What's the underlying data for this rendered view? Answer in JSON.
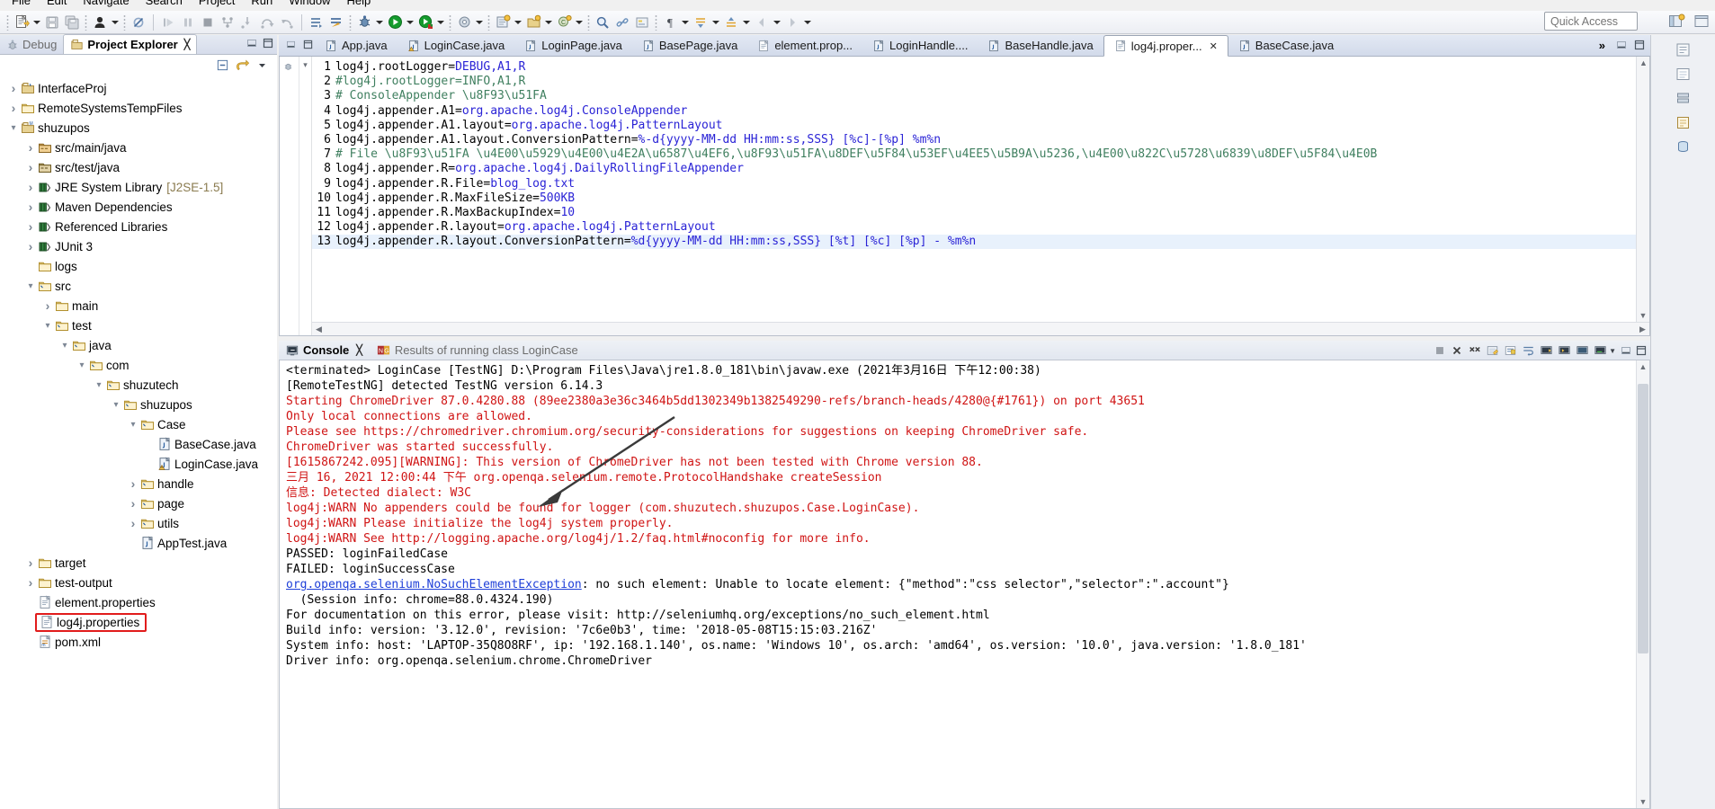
{
  "menu": {
    "items": [
      {
        "label": "File"
      },
      {
        "label": "Edit"
      },
      {
        "label": "Navigate"
      },
      {
        "label": "Search"
      },
      {
        "label": "Project"
      },
      {
        "label": "Run"
      },
      {
        "label": "Window"
      },
      {
        "label": "Help"
      }
    ]
  },
  "toolbar": {
    "quick_access_placeholder": "Quick Access",
    "icons": [
      "new-file-icon",
      "new-dropdown-icon",
      "save-icon",
      "save-all-icon",
      "user-icon",
      "user-dropdown-icon",
      "skip-breakpoints-icon",
      "resume-icon",
      "suspend-icon",
      "terminate-icon",
      "disconnect-icon",
      "step-into-icon",
      "step-over-icon",
      "step-return-icon",
      "open-task-icon",
      "open-type-icon",
      "debug-icon",
      "debug-dropdown-icon",
      "run-icon",
      "run-dropdown-icon",
      "coverage-icon",
      "coverage-dropdown-icon",
      "external-tools-icon",
      "external-tools-dropdown-icon",
      "new-java-project-icon",
      "new-package-icon",
      "new-class-icon",
      "search-icon",
      "link-icon",
      "toggle-markoccurrences-icon",
      "pilcrow-icon",
      "pilcrow-dropdown-icon",
      "forward-icon",
      "back-icon",
      "next-annotation-icon",
      "prev-annotation-icon"
    ]
  },
  "left_panel": {
    "tabs": [
      {
        "label": "Debug",
        "icon": "debug-icon",
        "active": false
      },
      {
        "label": "Project Explorer",
        "icon": "project-explorer-icon",
        "active": true,
        "closeable": true
      }
    ],
    "view_tools": [
      "collapse-all-icon",
      "link-with-editor-icon",
      "view-menu-icon"
    ],
    "tree": [
      {
        "indent": 0,
        "twist": "closed",
        "icon": "java-project-icon",
        "label": "InterfaceProj"
      },
      {
        "indent": 0,
        "twist": "closed",
        "icon": "folder-icon",
        "label": "RemoteSystemsTempFiles"
      },
      {
        "indent": 0,
        "twist": "open",
        "icon": "maven-project-icon",
        "label": "shuzupos"
      },
      {
        "indent": 1,
        "twist": "closed",
        "icon": "source-folder-icon",
        "label": "src/main/java"
      },
      {
        "indent": 1,
        "twist": "closed",
        "icon": "test-source-folder-icon",
        "label": "src/test/java"
      },
      {
        "indent": 1,
        "twist": "closed",
        "icon": "library-icon",
        "label": "JRE System Library",
        "dim": "[J2SE-1.5]"
      },
      {
        "indent": 1,
        "twist": "closed",
        "icon": "library-icon",
        "label": "Maven Dependencies"
      },
      {
        "indent": 1,
        "twist": "closed",
        "icon": "library-icon",
        "label": "Referenced Libraries"
      },
      {
        "indent": 1,
        "twist": "closed",
        "icon": "library-icon",
        "label": "JUnit 3"
      },
      {
        "indent": 1,
        "twist": "none",
        "icon": "folder-icon",
        "label": "logs"
      },
      {
        "indent": 1,
        "twist": "open",
        "icon": "src-folder-icon",
        "label": "src"
      },
      {
        "indent": 2,
        "twist": "closed",
        "icon": "folder-icon",
        "label": "main"
      },
      {
        "indent": 2,
        "twist": "open",
        "icon": "src-folder-icon",
        "label": "test"
      },
      {
        "indent": 3,
        "twist": "open",
        "icon": "src-folder-icon",
        "label": "java"
      },
      {
        "indent": 4,
        "twist": "open",
        "icon": "src-folder-icon",
        "label": "com"
      },
      {
        "indent": 5,
        "twist": "open",
        "icon": "src-folder-icon",
        "label": "shuzutech"
      },
      {
        "indent": 6,
        "twist": "open",
        "icon": "src-folder-icon",
        "label": "shuzupos"
      },
      {
        "indent": 7,
        "twist": "open",
        "icon": "src-folder-icon",
        "label": "Case"
      },
      {
        "indent": 8,
        "twist": "none",
        "icon": "java-file-icon",
        "label": "BaseCase.java"
      },
      {
        "indent": 8,
        "twist": "none",
        "icon": "java-file-warning-icon",
        "label": "LoginCase.java"
      },
      {
        "indent": 7,
        "twist": "closed",
        "icon": "src-folder-icon",
        "label": "handle"
      },
      {
        "indent": 7,
        "twist": "closed",
        "icon": "src-folder-icon",
        "label": "page"
      },
      {
        "indent": 7,
        "twist": "closed",
        "icon": "src-folder-icon",
        "label": "utils"
      },
      {
        "indent": 7,
        "twist": "none",
        "icon": "java-file-icon",
        "label": "AppTest.java"
      },
      {
        "indent": 1,
        "twist": "closed",
        "icon": "folder-icon",
        "label": "target"
      },
      {
        "indent": 1,
        "twist": "closed",
        "icon": "folder-icon",
        "label": "test-output"
      },
      {
        "indent": 1,
        "twist": "none",
        "icon": "properties-file-icon",
        "label": "element.properties"
      },
      {
        "indent": 1,
        "twist": "none",
        "icon": "properties-file-icon",
        "label": "log4j.properties",
        "selected": true
      },
      {
        "indent": 1,
        "twist": "none",
        "icon": "pom-file-icon",
        "label": "pom.xml"
      }
    ]
  },
  "editor": {
    "tabs": [
      {
        "label": "App.java",
        "icon": "java-file-icon",
        "active": false
      },
      {
        "label": "LoginCase.java",
        "icon": "java-file-warning-icon",
        "active": false
      },
      {
        "label": "LoginPage.java",
        "icon": "java-file-icon",
        "active": false
      },
      {
        "label": "BasePage.java",
        "icon": "java-file-icon",
        "active": false
      },
      {
        "label": "element.prop...",
        "icon": "properties-file-icon",
        "active": false
      },
      {
        "label": "LoginHandle....",
        "icon": "java-file-icon",
        "active": false
      },
      {
        "label": "BaseHandle.java",
        "icon": "java-file-icon",
        "active": false
      },
      {
        "label": "log4j.proper...",
        "icon": "properties-file-icon",
        "active": true,
        "closeable": true
      },
      {
        "label": "BaseCase.java",
        "icon": "java-file-icon",
        "active": false
      }
    ],
    "more_tabs_label": "»",
    "lines": [
      {
        "no": "1",
        "segs": [
          {
            "t": "log4j.rootLogger=",
            "c": "key"
          },
          {
            "t": "DEBUG,A1,R",
            "c": "val"
          }
        ]
      },
      {
        "no": "2",
        "segs": [
          {
            "t": "#log4j.rootLogger=INFO,A1,R",
            "c": "com"
          }
        ]
      },
      {
        "no": "3",
        "segs": [
          {
            "t": "# ConsoleAppender \\u8F93\\u51FA",
            "c": "com"
          }
        ]
      },
      {
        "no": "4",
        "segs": [
          {
            "t": "log4j.appender.A1=",
            "c": "key"
          },
          {
            "t": "org.apache.log4j.ConsoleAppender",
            "c": "val"
          }
        ]
      },
      {
        "no": "5",
        "segs": [
          {
            "t": "log4j.appender.A1.layout=",
            "c": "key"
          },
          {
            "t": "org.apache.log4j.PatternLayout",
            "c": "val"
          }
        ]
      },
      {
        "no": "6",
        "segs": [
          {
            "t": "log4j.appender.A1.layout.ConversionPattern=",
            "c": "key"
          },
          {
            "t": "%-d{yyyy-MM-dd HH:mm:ss,SSS} [%c]-[%p] %m%n",
            "c": "val"
          }
        ]
      },
      {
        "no": "7",
        "segs": [
          {
            "t": "# File \\u8F93\\u51FA \\u4E00\\u5929\\u4E00\\u4E2A\\u6587\\u4EF6,\\u8F93\\u51FA\\u8DEF\\u5F84\\u53EF\\u4EE5\\u5B9A\\u5236,\\u4E00\\u822C\\u5728\\u6839\\u8DEF\\u5F84\\u4E0B",
            "c": "com"
          }
        ]
      },
      {
        "no": "8",
        "segs": [
          {
            "t": "log4j.appender.R=",
            "c": "key"
          },
          {
            "t": "org.apache.log4j.DailyRollingFileAppender",
            "c": "val"
          }
        ]
      },
      {
        "no": "9",
        "segs": [
          {
            "t": "log4j.appender.R.File=",
            "c": "key"
          },
          {
            "t": "blog_log.txt",
            "c": "val"
          }
        ]
      },
      {
        "no": "10",
        "segs": [
          {
            "t": "log4j.appender.R.MaxFileSize=",
            "c": "key"
          },
          {
            "t": "500KB",
            "c": "val"
          }
        ]
      },
      {
        "no": "11",
        "segs": [
          {
            "t": "log4j.appender.R.MaxBackupIndex=",
            "c": "key"
          },
          {
            "t": "10",
            "c": "val"
          }
        ]
      },
      {
        "no": "12",
        "segs": [
          {
            "t": "log4j.appender.R.layout=",
            "c": "key"
          },
          {
            "t": "org.apache.log4j.PatternLayout",
            "c": "val"
          }
        ]
      },
      {
        "no": "13",
        "segs": [
          {
            "t": "log4j.appender.R.layout.ConversionPattern=",
            "c": "key"
          },
          {
            "t": "%d{yyyy-MM-dd HH:mm:ss,SSS} [%t] [%c] [%p] - %m%n",
            "c": "val"
          }
        ],
        "highlight": true
      }
    ]
  },
  "console": {
    "tabs": [
      {
        "label": "Console",
        "icon": "console-icon",
        "active": true,
        "closeable": true
      },
      {
        "label": "Results of running class LoginCase",
        "icon": "testng-icon",
        "active": false
      }
    ],
    "tools": [
      "terminate-icon",
      "remove-launch-icon",
      "remove-all-terminated-icon",
      "clear-console-icon",
      "scroll-lock-icon",
      "word-wrap-icon",
      "show-console-on-output-icon",
      "pin-console-icon",
      "display-selected-console-icon",
      "open-console-icon",
      "minimize-icon",
      "maximize-icon"
    ],
    "lines": [
      {
        "c": "black",
        "t": "<terminated> LoginCase [TestNG] D:\\Program Files\\Java\\jre1.8.0_181\\bin\\javaw.exe (2021年3月16日 下午12:00:38)"
      },
      {
        "c": "black",
        "t": "[RemoteTestNG] detected TestNG version 6.14.3"
      },
      {
        "c": "red",
        "t": "Starting ChromeDriver 87.0.4280.88 (89ee2380a3e36c3464b5dd1302349b1382549290-refs/branch-heads/4280@{#1761}) on port 43651"
      },
      {
        "c": "red",
        "t": "Only local connections are allowed."
      },
      {
        "c": "red",
        "t": "Please see https://chromedriver.chromium.org/security-considerations for suggestions on keeping ChromeDriver safe."
      },
      {
        "c": "red",
        "t": "ChromeDriver was started successfully."
      },
      {
        "c": "red",
        "t": "[1615867242.095][WARNING]: This version of ChromeDriver has not been tested with Chrome version 88."
      },
      {
        "c": "red",
        "t": "三月 16, 2021 12:00:44 下午 org.openqa.selenium.remote.ProtocolHandshake createSession"
      },
      {
        "c": "red",
        "t": "信息: Detected dialect: W3C"
      },
      {
        "c": "red",
        "t": "log4j:WARN No appenders could be found for logger (com.shuzutech.shuzupos.Case.LoginCase)."
      },
      {
        "c": "red",
        "t": "log4j:WARN Please initialize the log4j system properly."
      },
      {
        "c": "red",
        "t": "log4j:WARN See http://logging.apache.org/log4j/1.2/faq.html#noconfig for more info."
      },
      {
        "c": "black",
        "t": "PASSED: loginFailedCase"
      },
      {
        "c": "black",
        "t": "FAILED: loginSuccessCase"
      },
      {
        "c": "link",
        "t": "org.openqa.selenium.NoSuchElementException",
        "after": ": no such element: Unable to locate element: {\"method\":\"css selector\",\"selector\":\".account\"}"
      },
      {
        "c": "black",
        "t": "  (Session info: chrome=88.0.4324.190)"
      },
      {
        "c": "black",
        "t": "For documentation on this error, please visit: http://seleniumhq.org/exceptions/no_such_element.html"
      },
      {
        "c": "black",
        "t": "Build info: version: '3.12.0', revision: '7c6e0b3', time: '2018-05-08T15:15:03.216Z'"
      },
      {
        "c": "black",
        "t": "System info: host: 'LAPTOP-35Q8O8RF', ip: '192.168.1.140', os.name: 'Windows 10', os.arch: 'amd64', os.version: '10.0', java.version: '1.8.0_181'"
      },
      {
        "c": "black",
        "t": "Driver info: org.openqa.selenium.chrome.ChromeDriver"
      }
    ]
  },
  "colors": {
    "accent_red": "#d01414",
    "selection_box": "#e11c1c",
    "link_blue": "#1e3fd8",
    "code_value": "#2a23d6",
    "code_comment": "#3f7f5f",
    "highlight_line": "#e8f1fc"
  }
}
